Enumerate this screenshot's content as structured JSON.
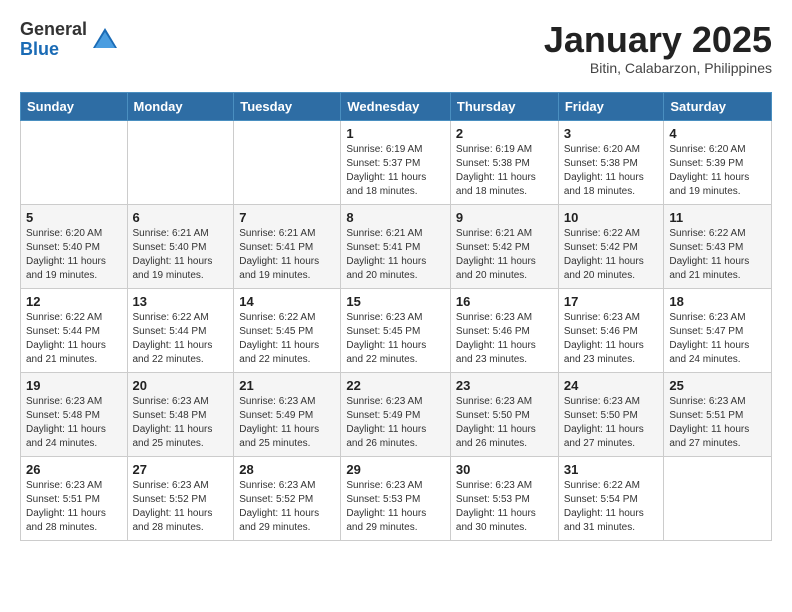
{
  "logo": {
    "general": "General",
    "blue": "Blue"
  },
  "header": {
    "title": "January 2025",
    "subtitle": "Bitin, Calabarzon, Philippines"
  },
  "weekdays": [
    "Sunday",
    "Monday",
    "Tuesday",
    "Wednesday",
    "Thursday",
    "Friday",
    "Saturday"
  ],
  "weeks": [
    [
      {
        "day": "",
        "sunrise": "",
        "sunset": "",
        "daylight": ""
      },
      {
        "day": "",
        "sunrise": "",
        "sunset": "",
        "daylight": ""
      },
      {
        "day": "",
        "sunrise": "",
        "sunset": "",
        "daylight": ""
      },
      {
        "day": "1",
        "sunrise": "Sunrise: 6:19 AM",
        "sunset": "Sunset: 5:37 PM",
        "daylight": "Daylight: 11 hours and 18 minutes."
      },
      {
        "day": "2",
        "sunrise": "Sunrise: 6:19 AM",
        "sunset": "Sunset: 5:38 PM",
        "daylight": "Daylight: 11 hours and 18 minutes."
      },
      {
        "day": "3",
        "sunrise": "Sunrise: 6:20 AM",
        "sunset": "Sunset: 5:38 PM",
        "daylight": "Daylight: 11 hours and 18 minutes."
      },
      {
        "day": "4",
        "sunrise": "Sunrise: 6:20 AM",
        "sunset": "Sunset: 5:39 PM",
        "daylight": "Daylight: 11 hours and 19 minutes."
      }
    ],
    [
      {
        "day": "5",
        "sunrise": "Sunrise: 6:20 AM",
        "sunset": "Sunset: 5:40 PM",
        "daylight": "Daylight: 11 hours and 19 minutes."
      },
      {
        "day": "6",
        "sunrise": "Sunrise: 6:21 AM",
        "sunset": "Sunset: 5:40 PM",
        "daylight": "Daylight: 11 hours and 19 minutes."
      },
      {
        "day": "7",
        "sunrise": "Sunrise: 6:21 AM",
        "sunset": "Sunset: 5:41 PM",
        "daylight": "Daylight: 11 hours and 19 minutes."
      },
      {
        "day": "8",
        "sunrise": "Sunrise: 6:21 AM",
        "sunset": "Sunset: 5:41 PM",
        "daylight": "Daylight: 11 hours and 20 minutes."
      },
      {
        "day": "9",
        "sunrise": "Sunrise: 6:21 AM",
        "sunset": "Sunset: 5:42 PM",
        "daylight": "Daylight: 11 hours and 20 minutes."
      },
      {
        "day": "10",
        "sunrise": "Sunrise: 6:22 AM",
        "sunset": "Sunset: 5:42 PM",
        "daylight": "Daylight: 11 hours and 20 minutes."
      },
      {
        "day": "11",
        "sunrise": "Sunrise: 6:22 AM",
        "sunset": "Sunset: 5:43 PM",
        "daylight": "Daylight: 11 hours and 21 minutes."
      }
    ],
    [
      {
        "day": "12",
        "sunrise": "Sunrise: 6:22 AM",
        "sunset": "Sunset: 5:44 PM",
        "daylight": "Daylight: 11 hours and 21 minutes."
      },
      {
        "day": "13",
        "sunrise": "Sunrise: 6:22 AM",
        "sunset": "Sunset: 5:44 PM",
        "daylight": "Daylight: 11 hours and 22 minutes."
      },
      {
        "day": "14",
        "sunrise": "Sunrise: 6:22 AM",
        "sunset": "Sunset: 5:45 PM",
        "daylight": "Daylight: 11 hours and 22 minutes."
      },
      {
        "day": "15",
        "sunrise": "Sunrise: 6:23 AM",
        "sunset": "Sunset: 5:45 PM",
        "daylight": "Daylight: 11 hours and 22 minutes."
      },
      {
        "day": "16",
        "sunrise": "Sunrise: 6:23 AM",
        "sunset": "Sunset: 5:46 PM",
        "daylight": "Daylight: 11 hours and 23 minutes."
      },
      {
        "day": "17",
        "sunrise": "Sunrise: 6:23 AM",
        "sunset": "Sunset: 5:46 PM",
        "daylight": "Daylight: 11 hours and 23 minutes."
      },
      {
        "day": "18",
        "sunrise": "Sunrise: 6:23 AM",
        "sunset": "Sunset: 5:47 PM",
        "daylight": "Daylight: 11 hours and 24 minutes."
      }
    ],
    [
      {
        "day": "19",
        "sunrise": "Sunrise: 6:23 AM",
        "sunset": "Sunset: 5:48 PM",
        "daylight": "Daylight: 11 hours and 24 minutes."
      },
      {
        "day": "20",
        "sunrise": "Sunrise: 6:23 AM",
        "sunset": "Sunset: 5:48 PM",
        "daylight": "Daylight: 11 hours and 25 minutes."
      },
      {
        "day": "21",
        "sunrise": "Sunrise: 6:23 AM",
        "sunset": "Sunset: 5:49 PM",
        "daylight": "Daylight: 11 hours and 25 minutes."
      },
      {
        "day": "22",
        "sunrise": "Sunrise: 6:23 AM",
        "sunset": "Sunset: 5:49 PM",
        "daylight": "Daylight: 11 hours and 26 minutes."
      },
      {
        "day": "23",
        "sunrise": "Sunrise: 6:23 AM",
        "sunset": "Sunset: 5:50 PM",
        "daylight": "Daylight: 11 hours and 26 minutes."
      },
      {
        "day": "24",
        "sunrise": "Sunrise: 6:23 AM",
        "sunset": "Sunset: 5:50 PM",
        "daylight": "Daylight: 11 hours and 27 minutes."
      },
      {
        "day": "25",
        "sunrise": "Sunrise: 6:23 AM",
        "sunset": "Sunset: 5:51 PM",
        "daylight": "Daylight: 11 hours and 27 minutes."
      }
    ],
    [
      {
        "day": "26",
        "sunrise": "Sunrise: 6:23 AM",
        "sunset": "Sunset: 5:51 PM",
        "daylight": "Daylight: 11 hours and 28 minutes."
      },
      {
        "day": "27",
        "sunrise": "Sunrise: 6:23 AM",
        "sunset": "Sunset: 5:52 PM",
        "daylight": "Daylight: 11 hours and 28 minutes."
      },
      {
        "day": "28",
        "sunrise": "Sunrise: 6:23 AM",
        "sunset": "Sunset: 5:52 PM",
        "daylight": "Daylight: 11 hours and 29 minutes."
      },
      {
        "day": "29",
        "sunrise": "Sunrise: 6:23 AM",
        "sunset": "Sunset: 5:53 PM",
        "daylight": "Daylight: 11 hours and 29 minutes."
      },
      {
        "day": "30",
        "sunrise": "Sunrise: 6:23 AM",
        "sunset": "Sunset: 5:53 PM",
        "daylight": "Daylight: 11 hours and 30 minutes."
      },
      {
        "day": "31",
        "sunrise": "Sunrise: 6:22 AM",
        "sunset": "Sunset: 5:54 PM",
        "daylight": "Daylight: 11 hours and 31 minutes."
      },
      {
        "day": "",
        "sunrise": "",
        "sunset": "",
        "daylight": ""
      }
    ]
  ]
}
